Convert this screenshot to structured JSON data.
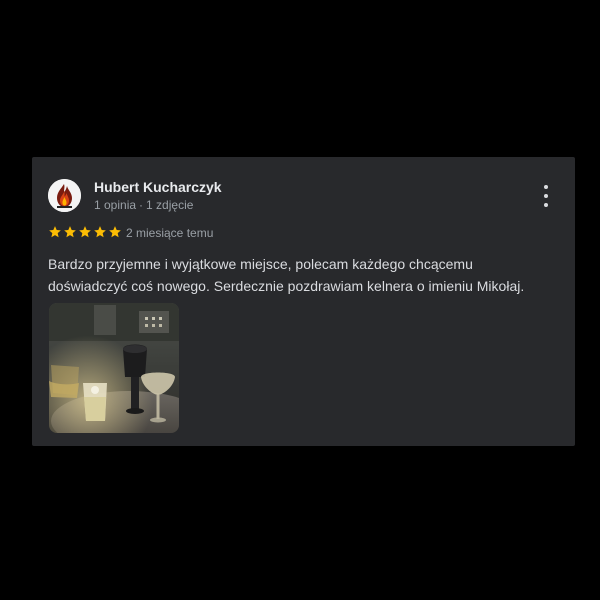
{
  "review": {
    "author_name": "Hubert Kucharczyk",
    "author_reviews": "1 opinia",
    "meta_separator": "·",
    "author_photos": "1 zdjęcie",
    "rating": 5,
    "rating_max": 5,
    "star_color": "#fbbc04",
    "time": "2 miesiące temu",
    "text_lines": [
      "Bardzo przyjemne i wyjątkowe miejsce, polecam każdego chcącemu",
      "doświadczyć coś nowego. Serdecznie pozdrawiam kelnera o imieniu Mikołaj."
    ],
    "avatar_icon": "flame-logo",
    "menu_icon": "more-vert-icon",
    "photo_description_icon": "photo-thumbnail"
  }
}
